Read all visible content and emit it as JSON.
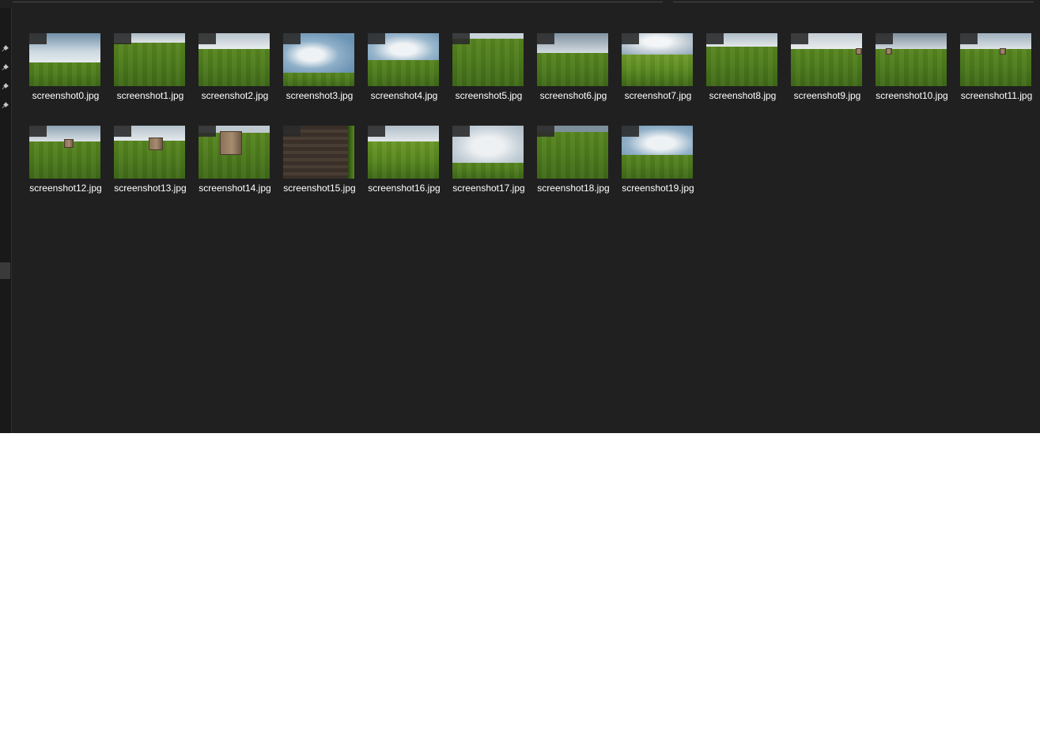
{
  "files": [
    {
      "name": "screenshot0.jpg",
      "thumbnail": "cloudy-sky-grass"
    },
    {
      "name": "screenshot1.jpg",
      "thumbnail": "grass-field"
    },
    {
      "name": "screenshot2.jpg",
      "thumbnail": "grass-field"
    },
    {
      "name": "screenshot3.jpg",
      "thumbnail": "cloudy-sky-grass"
    },
    {
      "name": "screenshot4.jpg",
      "thumbnail": "cloudy-sky-grass"
    },
    {
      "name": "screenshot5.jpg",
      "thumbnail": "grass-field"
    },
    {
      "name": "screenshot6.jpg",
      "thumbnail": "cloudy-sky-grass"
    },
    {
      "name": "screenshot7.jpg",
      "thumbnail": "cloudy-sky-grass"
    },
    {
      "name": "screenshot8.jpg",
      "thumbnail": "grass-field"
    },
    {
      "name": "screenshot9.jpg",
      "thumbnail": "grass-field-with-crate"
    },
    {
      "name": "screenshot10.jpg",
      "thumbnail": "grass-field-with-crate"
    },
    {
      "name": "screenshot11.jpg",
      "thumbnail": "grass-field-with-crate"
    },
    {
      "name": "screenshot12.jpg",
      "thumbnail": "grass-field-with-crate"
    },
    {
      "name": "screenshot13.jpg",
      "thumbnail": "grass-field-with-crate"
    },
    {
      "name": "screenshot14.jpg",
      "thumbnail": "grass-field-with-crate"
    },
    {
      "name": "screenshot15.jpg",
      "thumbnail": "crate-closeup"
    },
    {
      "name": "screenshot16.jpg",
      "thumbnail": "grass-field"
    },
    {
      "name": "screenshot17.jpg",
      "thumbnail": "cloudy-sky-grass"
    },
    {
      "name": "screenshot18.jpg",
      "thumbnail": "grass-field"
    },
    {
      "name": "screenshot19.jpg",
      "thumbnail": "cloudy-sky-grass"
    }
  ],
  "nav_pane": {
    "pin_icons": [
      "pin-icon",
      "pin-icon",
      "pin-icon",
      "pin-icon"
    ]
  },
  "colors": {
    "background": "#202020",
    "text": "#ffffff",
    "grass": "#4e7c1d",
    "sky": "#c9d6df"
  }
}
